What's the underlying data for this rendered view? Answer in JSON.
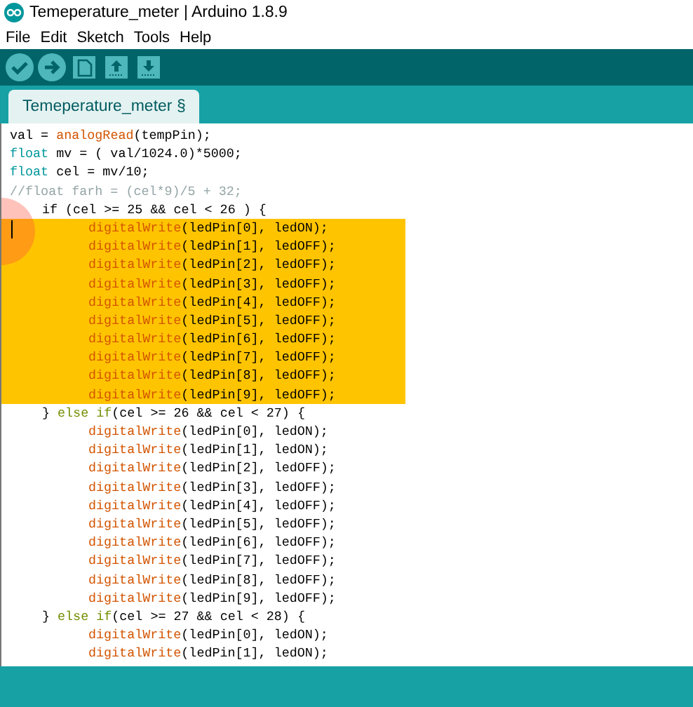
{
  "window": {
    "title": "Temeperature_meter | Arduino 1.8.9"
  },
  "menu": [
    "File",
    "Edit",
    "Sketch",
    "Tools",
    "Help"
  ],
  "toolbar": [
    {
      "kind": "verify"
    },
    {
      "kind": "upload"
    },
    {
      "kind": "new"
    },
    {
      "kind": "open"
    },
    {
      "kind": "save"
    }
  ],
  "tabs": [
    {
      "label": "Temeperature_meter §",
      "selected": true
    }
  ],
  "code": [
    {
      "kind": "top",
      "selected": false,
      "tokens": [
        {
          "text": "val = ",
          "kind": "plain"
        },
        {
          "text": "analogRead",
          "kind": "function"
        },
        {
          "text": "(tempPin);",
          "kind": "plain"
        }
      ]
    },
    {
      "kind": "top",
      "selected": false,
      "tokens": [
        {
          "text": "float",
          "kind": "type"
        },
        {
          "text": " mv = ( val/1024.0)*5000;",
          "kind": "plain"
        }
      ]
    },
    {
      "kind": "top",
      "selected": false,
      "tokens": [
        {
          "text": "float",
          "kind": "type"
        },
        {
          "text": " cel = mv/10;",
          "kind": "plain"
        }
      ]
    },
    {
      "kind": "top",
      "selected": false,
      "tokens": [
        {
          "text": "//float farh = (cel*9)/5 + 32;",
          "kind": "comment"
        }
      ]
    },
    {
      "kind": "block",
      "selected": false,
      "tokens": [
        {
          "text": "if (cel >= 25 && cel < 26 ) {",
          "kind": "plain"
        }
      ]
    },
    {
      "kind": "inner",
      "selected": true,
      "tokens": [
        {
          "text": "digitalWrite",
          "kind": "function"
        },
        {
          "text": "(ledPin[0], ledON);",
          "kind": "plain"
        }
      ]
    },
    {
      "kind": "inner",
      "selected": true,
      "tokens": [
        {
          "text": "digitalWrite",
          "kind": "function"
        },
        {
          "text": "(ledPin[1], ledOFF);",
          "kind": "plain"
        }
      ]
    },
    {
      "kind": "inner",
      "selected": true,
      "tokens": [
        {
          "text": "digitalWrite",
          "kind": "function"
        },
        {
          "text": "(ledPin[2], ledOFF);",
          "kind": "plain"
        }
      ]
    },
    {
      "kind": "inner",
      "selected": true,
      "tokens": [
        {
          "text": "digitalWrite",
          "kind": "function"
        },
        {
          "text": "(ledPin[3], ledOFF);",
          "kind": "plain"
        }
      ]
    },
    {
      "kind": "inner",
      "selected": true,
      "tokens": [
        {
          "text": "digitalWrite",
          "kind": "function"
        },
        {
          "text": "(ledPin[4], ledOFF);",
          "kind": "plain"
        }
      ]
    },
    {
      "kind": "inner",
      "selected": true,
      "tokens": [
        {
          "text": "digitalWrite",
          "kind": "function"
        },
        {
          "text": "(ledPin[5], ledOFF);",
          "kind": "plain"
        }
      ]
    },
    {
      "kind": "inner",
      "selected": true,
      "tokens": [
        {
          "text": "digitalWrite",
          "kind": "function"
        },
        {
          "text": "(ledPin[6], ledOFF);",
          "kind": "plain"
        }
      ]
    },
    {
      "kind": "inner",
      "selected": true,
      "tokens": [
        {
          "text": "digitalWrite",
          "kind": "function"
        },
        {
          "text": "(ledPin[7], ledOFF);",
          "kind": "plain"
        }
      ]
    },
    {
      "kind": "inner",
      "selected": true,
      "tokens": [
        {
          "text": "digitalWrite",
          "kind": "function"
        },
        {
          "text": "(ledPin[8], ledOFF);",
          "kind": "plain"
        }
      ]
    },
    {
      "kind": "inner",
      "selected": true,
      "tokens": [
        {
          "text": "digitalWrite",
          "kind": "function"
        },
        {
          "text": "(ledPin[9], ledOFF);",
          "kind": "plain"
        }
      ]
    },
    {
      "kind": "block",
      "selected": false,
      "tokens": [
        {
          "text": "} ",
          "kind": "plain"
        },
        {
          "text": "else if",
          "kind": "keyword"
        },
        {
          "text": "(cel >= 26 && cel < 27) {",
          "kind": "plain"
        }
      ]
    },
    {
      "kind": "inner",
      "selected": false,
      "tokens": [
        {
          "text": "digitalWrite",
          "kind": "function"
        },
        {
          "text": "(ledPin[0], ledON);",
          "kind": "plain"
        }
      ]
    },
    {
      "kind": "inner",
      "selected": false,
      "tokens": [
        {
          "text": "digitalWrite",
          "kind": "function"
        },
        {
          "text": "(ledPin[1], ledON);",
          "kind": "plain"
        }
      ]
    },
    {
      "kind": "inner",
      "selected": false,
      "tokens": [
        {
          "text": "digitalWrite",
          "kind": "function"
        },
        {
          "text": "(ledPin[2], ledOFF);",
          "kind": "plain"
        }
      ]
    },
    {
      "kind": "inner",
      "selected": false,
      "tokens": [
        {
          "text": "digitalWrite",
          "kind": "function"
        },
        {
          "text": "(ledPin[3], ledOFF);",
          "kind": "plain"
        }
      ]
    },
    {
      "kind": "inner",
      "selected": false,
      "tokens": [
        {
          "text": "digitalWrite",
          "kind": "function"
        },
        {
          "text": "(ledPin[4], ledOFF);",
          "kind": "plain"
        }
      ]
    },
    {
      "kind": "inner",
      "selected": false,
      "tokens": [
        {
          "text": "digitalWrite",
          "kind": "function"
        },
        {
          "text": "(ledPin[5], ledOFF);",
          "kind": "plain"
        }
      ]
    },
    {
      "kind": "inner",
      "selected": false,
      "tokens": [
        {
          "text": "digitalWrite",
          "kind": "function"
        },
        {
          "text": "(ledPin[6], ledOFF);",
          "kind": "plain"
        }
      ]
    },
    {
      "kind": "inner",
      "selected": false,
      "tokens": [
        {
          "text": "digitalWrite",
          "kind": "function"
        },
        {
          "text": "(ledPin[7], ledOFF);",
          "kind": "plain"
        }
      ]
    },
    {
      "kind": "inner",
      "selected": false,
      "tokens": [
        {
          "text": "digitalWrite",
          "kind": "function"
        },
        {
          "text": "(ledPin[8], ledOFF);",
          "kind": "plain"
        }
      ]
    },
    {
      "kind": "inner",
      "selected": false,
      "tokens": [
        {
          "text": "digitalWrite",
          "kind": "function"
        },
        {
          "text": "(ledPin[9], ledOFF);",
          "kind": "plain"
        }
      ]
    },
    {
      "kind": "block",
      "selected": false,
      "tokens": [
        {
          "text": "} ",
          "kind": "plain"
        },
        {
          "text": "else if",
          "kind": "keyword"
        },
        {
          "text": "(cel >= 27 && cel < 28) {",
          "kind": "plain"
        }
      ]
    },
    {
      "kind": "inner",
      "selected": false,
      "tokens": [
        {
          "text": "digitalWrite",
          "kind": "function"
        },
        {
          "text": "(ledPin[0], ledON);",
          "kind": "plain"
        }
      ]
    },
    {
      "kind": "inner",
      "selected": false,
      "tokens": [
        {
          "text": "digitalWrite",
          "kind": "function"
        },
        {
          "text": "(ledPin[1], ledON);",
          "kind": "plain"
        }
      ]
    }
  ]
}
